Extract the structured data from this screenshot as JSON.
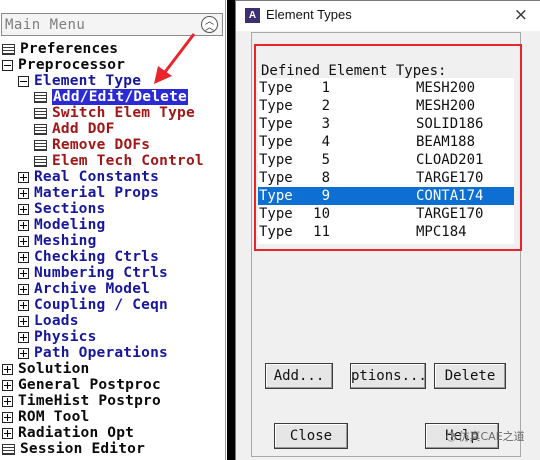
{
  "main_menu": {
    "title": "Main Menu",
    "items": [
      {
        "label": "Preferences",
        "kind": "leaf",
        "color": "#0a0a0a"
      },
      {
        "label": "Preprocessor",
        "kind": "open",
        "color": "#0a0a0a"
      },
      {
        "label": "Element Type",
        "kind": "open",
        "color": "#17179a"
      },
      {
        "label": "Add/Edit/Delete",
        "kind": "leaf",
        "color": "#ffffff",
        "selected": true
      },
      {
        "label": "Switch Elem Type",
        "kind": "leaf",
        "color": "#a11717"
      },
      {
        "label": "Add DOF",
        "kind": "leaf",
        "color": "#a11717"
      },
      {
        "label": "Remove DOFs",
        "kind": "leaf",
        "color": "#a11717"
      },
      {
        "label": "Elem Tech Control",
        "kind": "leaf",
        "color": "#a11717"
      },
      {
        "label": "Real Constants",
        "kind": "closed",
        "color": "#17179a"
      },
      {
        "label": "Material Props",
        "kind": "closed",
        "color": "#17179a"
      },
      {
        "label": "Sections",
        "kind": "closed",
        "color": "#17179a"
      },
      {
        "label": "Modeling",
        "kind": "closed",
        "color": "#17179a"
      },
      {
        "label": "Meshing",
        "kind": "closed",
        "color": "#17179a"
      },
      {
        "label": "Checking Ctrls",
        "kind": "closed",
        "color": "#17179a"
      },
      {
        "label": "Numbering Ctrls",
        "kind": "closed",
        "color": "#17179a"
      },
      {
        "label": "Archive Model",
        "kind": "closed",
        "color": "#17179a"
      },
      {
        "label": "Coupling / Ceqn",
        "kind": "closed",
        "color": "#17179a"
      },
      {
        "label": "Loads",
        "kind": "closed",
        "color": "#17179a"
      },
      {
        "label": "Physics",
        "kind": "closed",
        "color": "#17179a"
      },
      {
        "label": "Path Operations",
        "kind": "closed",
        "color": "#17179a"
      },
      {
        "label": "Solution",
        "kind": "closed",
        "color": "#0a0a0a"
      },
      {
        "label": "General Postproc",
        "kind": "closed",
        "color": "#0a0a0a"
      },
      {
        "label": "TimeHist Postpro",
        "kind": "closed",
        "color": "#0a0a0a"
      },
      {
        "label": "ROM Tool",
        "kind": "closed",
        "color": "#0a0a0a"
      },
      {
        "label": "Radiation Opt",
        "kind": "closed",
        "color": "#0a0a0a"
      },
      {
        "label": "Session Editor",
        "kind": "leaf",
        "color": "#0a0a0a"
      }
    ]
  },
  "dialog": {
    "title": "Element Types",
    "icon_letter": "A",
    "close_glyph": "×",
    "list_header": "Defined Element Types:",
    "rows": [
      {
        "type": "Type",
        "num": "1",
        "name": "MESH200",
        "selected": false
      },
      {
        "type": "Type",
        "num": "2",
        "name": "MESH200",
        "selected": false
      },
      {
        "type": "Type",
        "num": "3",
        "name": "SOLID186",
        "selected": false
      },
      {
        "type": "Type",
        "num": "4",
        "name": "BEAM188",
        "selected": false
      },
      {
        "type": "Type",
        "num": "5",
        "name": "CLOAD201",
        "selected": false
      },
      {
        "type": "Type",
        "num": "8",
        "name": "TARGE170",
        "selected": false
      },
      {
        "type": "Type",
        "num": "9",
        "name": "CONTA174",
        "selected": true
      },
      {
        "type": "Type",
        "num": "10",
        "name": "TARGE170",
        "selected": false
      },
      {
        "type": "Type",
        "num": "11",
        "name": "MPC184",
        "selected": false
      }
    ],
    "buttons": {
      "add": "Add...",
      "options": "ptions...",
      "delete": "Delete",
      "close": "Close",
      "help": "Help"
    }
  },
  "watermark": {
    "text": "仿真CAE之道",
    "icon": "chat-bubble-icon"
  },
  "colors": {
    "highlight_red": "#e8252b",
    "selection_blue": "#0d6fd1",
    "menu_selected": "#2b2bd6",
    "workspace": "#000000"
  }
}
